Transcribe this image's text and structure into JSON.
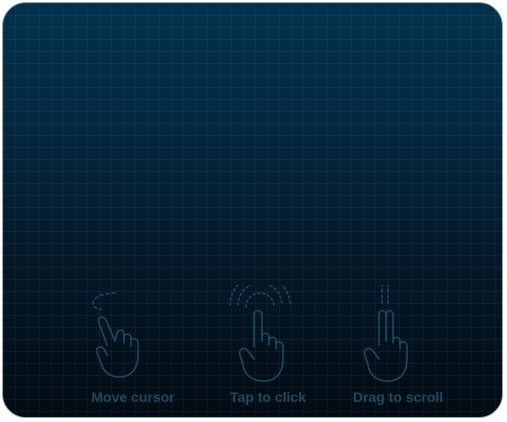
{
  "trackpad": {
    "gestures": [
      {
        "label": "Move cursor",
        "icon": "move-cursor-hand-icon"
      },
      {
        "label": "Tap to click",
        "icon": "tap-hand-icon"
      },
      {
        "label": "Drag to scroll",
        "icon": "scroll-hand-icon"
      }
    ]
  },
  "colors": {
    "background_top": "#03314c",
    "background_bottom": "#020b13",
    "icon_stroke": "#1b4a60",
    "label_text": "#1b4a60"
  }
}
